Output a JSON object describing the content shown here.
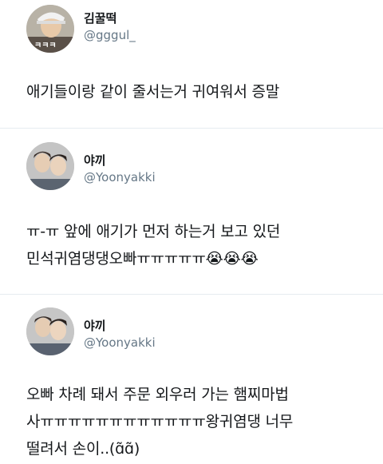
{
  "tweets": [
    {
      "display_name": "김꿀떡",
      "handle": "@gggul_",
      "text": "애기들이랑 같이 줄서는거 귀여워서 증말",
      "avatar_caption": "ㅋㅋㅋ"
    },
    {
      "display_name": "야끼",
      "handle": "@Yoonyakki",
      "text": "ㅠ-ㅠ 앞에 애기가 먼저 하는거 보고 있던\n민석귀염댕댕오빠ㅠㅠㅠㅠㅠ😭😭😭"
    },
    {
      "display_name": "야끼",
      "handle": "@Yoonyakki",
      "text": "오빠 차례 돼서 주문 외우러 가는 햄찌마법\n사ㅠㅠㅠㅠㅠㅠㅠㅠㅠㅠㅠㅠ왕귀염댕 너무\n떨려서 손이..(ɑ̃ɑ̃)"
    }
  ]
}
